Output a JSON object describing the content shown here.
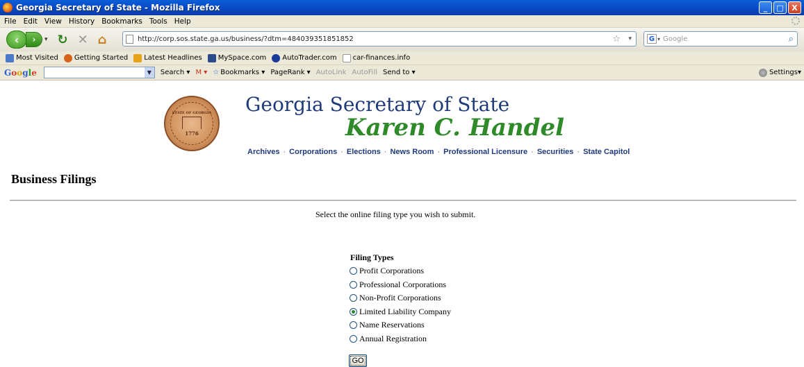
{
  "window": {
    "title": "Georgia Secretary of State - Mozilla Firefox",
    "controls": [
      "_",
      "□",
      "X"
    ]
  },
  "menu": {
    "items": [
      "File",
      "Edit",
      "View",
      "History",
      "Bookmarks",
      "Tools",
      "Help"
    ]
  },
  "navbar": {
    "url": "http://corp.sos.state.ga.us/business/?dtm=484039351851852",
    "search_placeholder": "Google"
  },
  "bookmarks": {
    "items": [
      {
        "label": "Most Visited",
        "color": "#4a7ac8"
      },
      {
        "label": "Getting Started",
        "color": "#d8641c"
      },
      {
        "label": "Latest Headlines",
        "color": "#e8a21c"
      },
      {
        "label": "MySpace.com",
        "color": "#2a4a8a"
      },
      {
        "label": "AutoTrader.com",
        "color": "#1a3a9a"
      },
      {
        "label": "car-finances.info",
        "color": "#bbbbbb"
      }
    ]
  },
  "google_toolbar": {
    "items": [
      {
        "label": "Search ▾",
        "dim": false
      },
      {
        "label": "M ▾",
        "dim": false
      },
      {
        "label": "Bookmarks ▾",
        "dim": false
      },
      {
        "label": "PageRank ▾",
        "dim": false
      },
      {
        "label": "AutoLink",
        "dim": true
      },
      {
        "label": "AutoFill",
        "dim": true
      },
      {
        "label": "Send to ▾",
        "dim": false
      }
    ],
    "settings_label": "Settings▾"
  },
  "page": {
    "seal_top": "STATE OF GEORGIA",
    "seal_year": "1776",
    "site_title": "Georgia Secretary of State",
    "official_name": "Karen C. Handel",
    "nav_links": [
      "Archives",
      "Corporations",
      "Elections",
      "News Room",
      "Professional Licensure",
      "Securities",
      "State Capitol"
    ],
    "heading": "Business Filings",
    "instruction": "Select the online filing type you wish to submit.",
    "filing_types_label": "Filing Types",
    "filing_types": [
      {
        "label": "Profit Corporations",
        "checked": false
      },
      {
        "label": "Professional Corporations",
        "checked": false
      },
      {
        "label": "Non-Profit Corporations",
        "checked": false
      },
      {
        "label": "Limited Liability Company",
        "checked": true
      },
      {
        "label": "Name Reservations",
        "checked": false
      },
      {
        "label": "Annual Registration",
        "checked": false
      }
    ],
    "go_label": "GO"
  }
}
